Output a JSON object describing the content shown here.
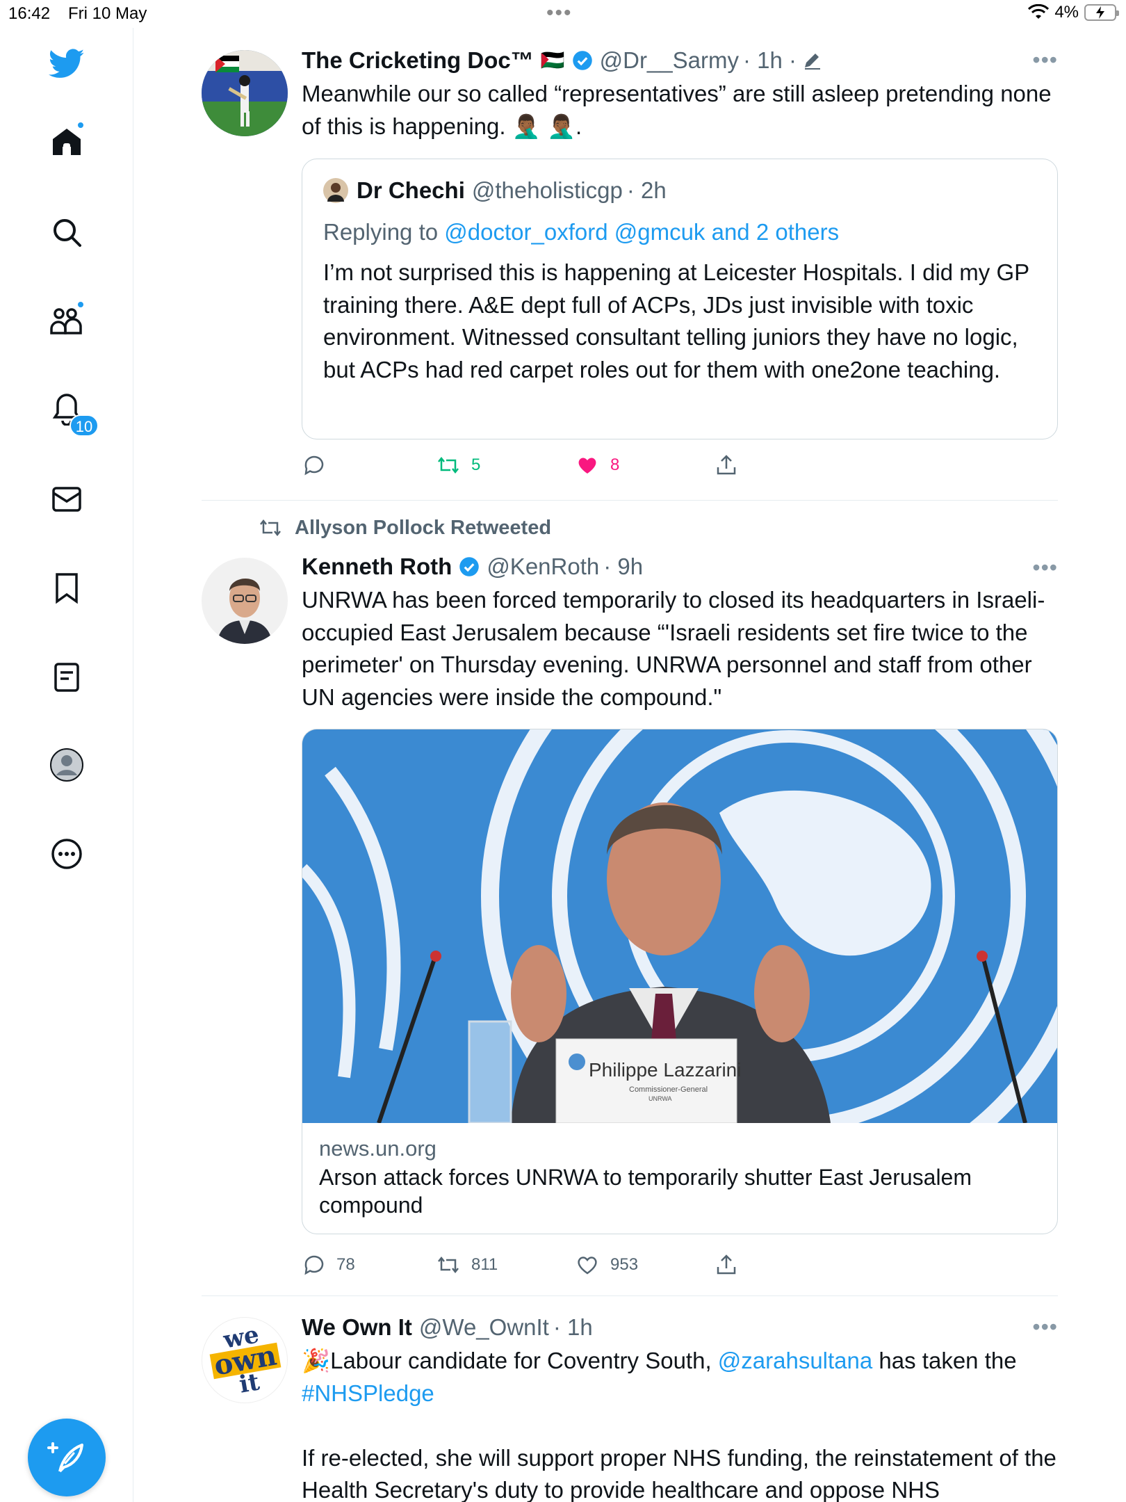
{
  "status_bar": {
    "time": "16:42",
    "date": "Fri 10 May",
    "battery": "4%"
  },
  "sidebar": {
    "items": [
      {
        "name": "home",
        "icon": "home-icon"
      },
      {
        "name": "explore",
        "icon": "search-icon"
      },
      {
        "name": "communities",
        "icon": "communities-icon"
      },
      {
        "name": "notifications",
        "icon": "bell-icon",
        "badge": "10"
      },
      {
        "name": "messages",
        "icon": "mail-icon"
      },
      {
        "name": "bookmarks",
        "icon": "bookmark-icon"
      },
      {
        "name": "lists",
        "icon": "list-icon"
      },
      {
        "name": "profile",
        "icon": "profile-icon"
      },
      {
        "name": "more",
        "icon": "more-circle-icon"
      }
    ],
    "compose_icon": "compose-icon"
  },
  "tweets": [
    {
      "name": "The Cricketing Doc™",
      "flag": "🇵🇸",
      "handle": "@Dr__Sarmy",
      "time": "· 1h ·",
      "text": "Meanwhile our so called “representatives” are still asleep pretending none of this is happening. 🤦🏾‍♂️ 🤦🏾‍♂️.",
      "quote": {
        "name": "Dr Chechi",
        "handle": "@theholisticgp",
        "time": "· 2h",
        "replying_prefix": "Replying to",
        "replying_to": "@doctor_oxford @gmcuk and 2 others",
        "text": "I’m not surprised this is happening at Leicester Hospitals. I did my GP training there. A&E dept full of ACPs, JDs just invisible with toxic environment. Witnessed consultant telling juniors they have no logic, but ACPs had red carpet roles out for them with one2one teaching."
      },
      "actions": {
        "replies": "",
        "retweets": "5",
        "likes": "8"
      },
      "colors": {
        "retweet": "#00ba7c",
        "like": "#f91880"
      }
    },
    {
      "retweeted_by": "Allyson Pollock Retweeted",
      "name": "Kenneth Roth",
      "handle": "@KenRoth",
      "time": "· 9h",
      "text": "UNRWA has been forced temporarily to closed its headquarters in Israeli-occupied East Jerusalem because “'Israeli residents set fire twice to the perimeter' on Thursday evening. UNRWA personnel and staff from other UN agencies were inside the compound.\"",
      "card": {
        "image_nameplate": "Philippe Lazzarini",
        "image_nameplate_sub": "Commissioner-General",
        "image_nameplate_org": "UNRWA",
        "domain": "news.un.org",
        "title": "Arson attack forces UNRWA to temporarily shutter East Jerusalem compound"
      },
      "actions": {
        "replies": "78",
        "retweets": "811",
        "likes": "953"
      }
    },
    {
      "name": "We Own It",
      "handle": "@We_OwnIt",
      "time": "· 1h",
      "avatar_text": [
        "we",
        "own",
        "it"
      ],
      "text_emoji": "🎉",
      "text_part1": "Labour candidate for Coventry South, ",
      "mention": "@zarahsultana",
      "text_part2": " has taken the",
      "hashtag": "#NHSPledge",
      "text_para2": "If re-elected, she will support proper NHS funding, the reinstatement of the Health Secretary's duty to provide healthcare and oppose NHS"
    }
  ],
  "colors": {
    "accent": "#1d9bf0",
    "text": "#0f1419",
    "secondary": "#536471",
    "divider": "#e6ecf0"
  }
}
